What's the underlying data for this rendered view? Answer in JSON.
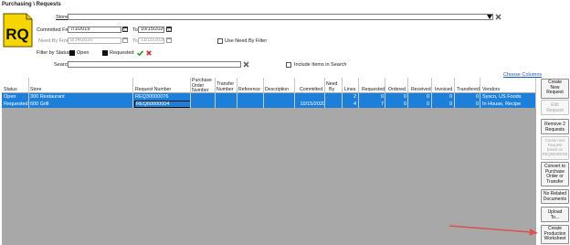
{
  "breadcrumb": "Purchasing \\ Requests",
  "logo_text": "RQ",
  "filters": {
    "store_label": "Store",
    "store_value": "",
    "committed_from_label": "Committed From",
    "committed_from_value": "7/1/2019",
    "committed_to_label": "To",
    "committed_to_value": "10/15/2020",
    "need_by_from_label": "Need By From",
    "need_by_from_value": "8/14/2020",
    "need_by_to_label": "To",
    "need_by_to_value": "11/15/2020",
    "use_need_by_label": "Use Need By Filter",
    "filter_status_label": "Filter by Status:",
    "status_open_label": "Open",
    "status_requested_label": "Requested",
    "search_label": "Search",
    "search_value": "",
    "include_items_label": "Include Items in Search"
  },
  "choose_columns": "Choose Columns",
  "columns": {
    "status": "Status",
    "store": "Store",
    "request_number": "Request Number",
    "purchase_order_number": [
      "Purchase",
      "Order",
      "Number"
    ],
    "transfer_number": [
      "Transfer",
      "Number"
    ],
    "reference": "Reference",
    "description": "Description",
    "committed": "Committed",
    "need_by": [
      "Need",
      "By"
    ],
    "lines": "Lines",
    "requested": "Requested",
    "ordered": "Ordered",
    "received": "Received",
    "invoiced": "Invoiced",
    "transferred": "Transfered",
    "vendors": "Vendors"
  },
  "rows": [
    {
      "status": "Open",
      "store": "300 Restaurant",
      "request_number": "REQ30000076",
      "committed": "",
      "lines": "2",
      "requested": "0",
      "ordered": "0",
      "received": "0",
      "invoiced": "0",
      "transferred": "0",
      "vendors": "Sysco, US Foods"
    },
    {
      "status": "Requested",
      "store": "600 Grill",
      "request_number": "REQ60000004",
      "committed": "10/15/2020",
      "lines": "4",
      "requested": "7",
      "ordered": "0",
      "received": "0",
      "invoiced": "0",
      "transferred": "0",
      "vendors": "In House, Recipe"
    }
  ],
  "side_buttons": {
    "create_new_request": [
      "Create",
      "New",
      "Request"
    ],
    "edit_request": [
      "Edit",
      "Request"
    ],
    "remove_requests": [
      "Remove 2",
      "Requests"
    ],
    "create_next_request": [
      "Create next",
      "Request",
      "based on",
      "REQ60000004"
    ],
    "convert": [
      "Convert to",
      "Purchase",
      "Order or",
      "Transfer"
    ],
    "no_related_documents": [
      "No Related",
      "Documents"
    ],
    "upload": [
      "Upload",
      "To..."
    ],
    "create_production_worksheet": [
      "Create",
      "Production",
      "Worksheet"
    ]
  },
  "colors": {
    "selection": "#1e7fd8",
    "logo_yellow": "#f7d500",
    "arrow": "#d9534f",
    "link": "#1a55c4"
  },
  "icons": [
    "requests-logo",
    "dropdown-arrow-icon",
    "clear-x-icon",
    "calendar-icon",
    "checkmark-icon",
    "red-x-icon"
  ]
}
